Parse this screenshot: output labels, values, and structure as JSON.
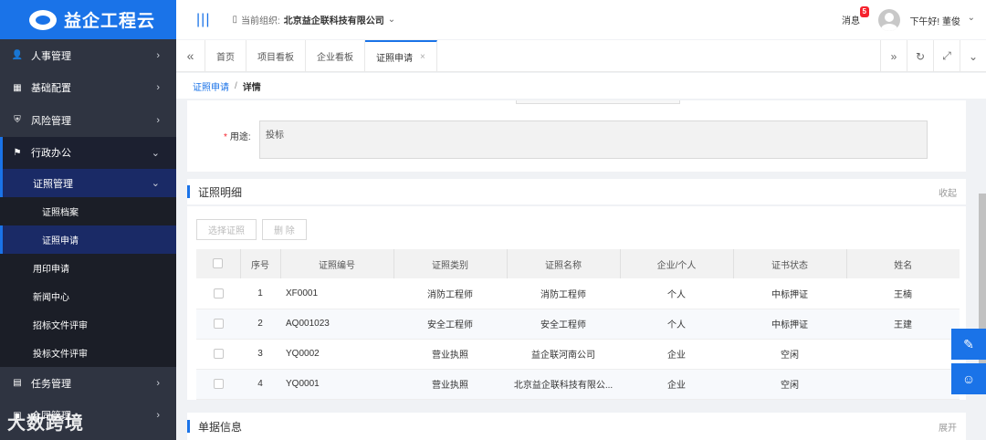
{
  "app": {
    "name": "益企工程云"
  },
  "sidebar": {
    "items": [
      {
        "icon": "user-icon",
        "glyph": "👤",
        "label": "人事管理"
      },
      {
        "icon": "grid-icon",
        "glyph": "▦",
        "label": "基础配置"
      },
      {
        "icon": "shield-icon",
        "glyph": "⛨",
        "label": "风险管理"
      },
      {
        "icon": "flag-icon",
        "glyph": "⚑",
        "label": "行政办公"
      }
    ],
    "sub_group": "证照管理",
    "sub_group_children": [
      "证照档案",
      "证照申请"
    ],
    "other_children": [
      "用印申请",
      "新闻中心",
      "招标文件评审",
      "投标文件评审"
    ],
    "tail_items": [
      {
        "icon": "list-icon",
        "glyph": "▤",
        "label": "任务管理"
      },
      {
        "icon": "folder-icon",
        "glyph": "▣",
        "label": "合同管理"
      }
    ],
    "watermark": "大数跨境"
  },
  "header": {
    "org_label": "当前组织:",
    "org_name": "北京益企联科技有限公司",
    "messages_label": "消息",
    "messages_count": "5",
    "greeting": "下午好! 董俊"
  },
  "tabs": [
    "首页",
    "项目看板",
    "企业看板",
    "证照申请"
  ],
  "breadcrumb": {
    "parent": "证照申请",
    "sep": "/",
    "current": "详情"
  },
  "form": {
    "use_label": "用途:",
    "use_value": "投标"
  },
  "detail_section": {
    "title": "证照明细",
    "toggle": "收起"
  },
  "buttons": {
    "select": "选择证照",
    "delete": "删 除"
  },
  "table": {
    "columns": [
      "序号",
      "证照编号",
      "证照类别",
      "证照名称",
      "企业/个人",
      "证书状态",
      "姓名"
    ],
    "rows": [
      {
        "no": "1",
        "code": "XF0001",
        "type": "消防工程师",
        "name": "消防工程师",
        "owner": "个人",
        "status": "中标押证",
        "person": "王楠"
      },
      {
        "no": "2",
        "code": "AQ001023",
        "type": "安全工程师",
        "name": "安全工程师",
        "owner": "个人",
        "status": "中标押证",
        "person": "王建"
      },
      {
        "no": "3",
        "code": "YQ0002",
        "type": "营业执照",
        "name": "益企联河南公司",
        "owner": "企业",
        "status": "空闲",
        "person": ""
      },
      {
        "no": "4",
        "code": "YQ0001",
        "type": "营业执照",
        "name": "北京益企联科技有限公...",
        "owner": "企业",
        "status": "空闲",
        "person": ""
      }
    ]
  },
  "doc_section": {
    "title": "单据信息",
    "toggle": "展开"
  }
}
